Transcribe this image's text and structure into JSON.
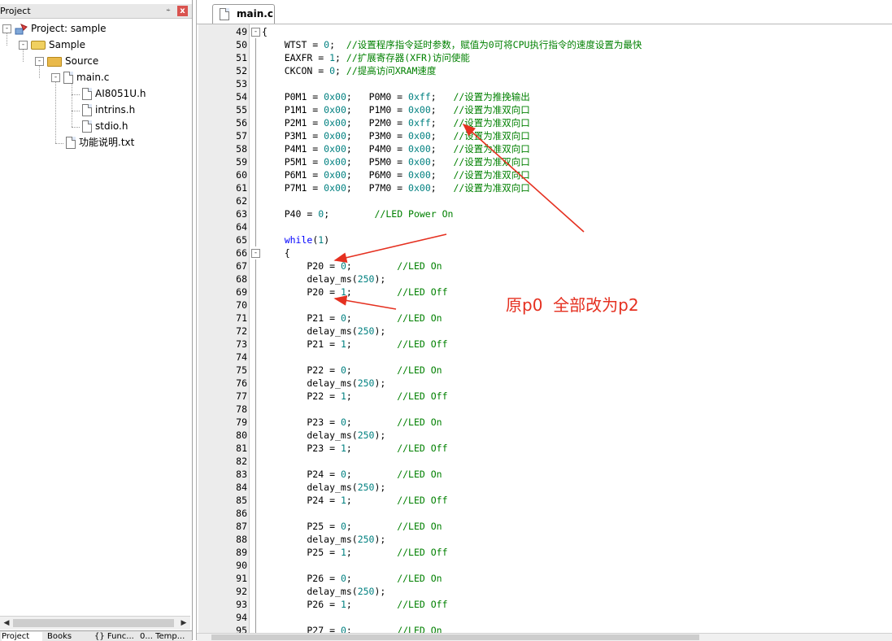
{
  "project_panel": {
    "title": "Project",
    "pin_glyph": "⍅",
    "close_glyph": "x",
    "tree": [
      {
        "label": "Project: sample",
        "icon": "project-icon",
        "expander": "-"
      },
      {
        "label": "Sample",
        "icon": "target-icon",
        "expander": "-"
      },
      {
        "label": "Source",
        "icon": "folder-icon",
        "expander": "-"
      },
      {
        "label": "main.c",
        "icon": "file-icon",
        "expander": "-"
      },
      {
        "label": "AI8051U.h",
        "icon": "file-icon"
      },
      {
        "label": "intrins.h",
        "icon": "file-icon"
      },
      {
        "label": "stdio.h",
        "icon": "file-icon"
      },
      {
        "label": "功能说明.txt",
        "icon": "file-icon"
      }
    ],
    "bottom_tabs": [
      "Project",
      "Books",
      "{} Func...",
      "0... Temp..."
    ]
  },
  "editor": {
    "tab_label": "main.c",
    "lines": [
      {
        "n": "49",
        "fold": "-",
        "code": [
          [
            "{",
            ""
          ]
        ]
      },
      {
        "n": "50",
        "code": [
          [
            "    WTST = ",
            ""
          ],
          [
            "0",
            "num"
          ],
          [
            ";  ",
            ""
          ],
          [
            "//设置程序指令延时参数，赋值为0可将CPU执行指令的速度设置为最快",
            "cm"
          ]
        ]
      },
      {
        "n": "51",
        "code": [
          [
            "    EAXFR = ",
            ""
          ],
          [
            "1",
            "num"
          ],
          [
            "; ",
            ""
          ],
          [
            "//扩展寄存器(XFR)访问使能",
            "cm"
          ]
        ]
      },
      {
        "n": "52",
        "code": [
          [
            "    CKCON = ",
            ""
          ],
          [
            "0",
            "num"
          ],
          [
            "; ",
            ""
          ],
          [
            "//提高访问XRAM速度",
            "cm"
          ]
        ]
      },
      {
        "n": "53",
        "code": []
      },
      {
        "n": "54",
        "code": [
          [
            "    P0M1 = ",
            ""
          ],
          [
            "0x00",
            "num"
          ],
          [
            ";   P0M0 = ",
            ""
          ],
          [
            "0xff",
            "num"
          ],
          [
            ";   ",
            ""
          ],
          [
            "//设置为推挽输出",
            "cm"
          ]
        ]
      },
      {
        "n": "55",
        "code": [
          [
            "    P1M1 = ",
            ""
          ],
          [
            "0x00",
            "num"
          ],
          [
            ";   P1M0 = ",
            ""
          ],
          [
            "0x00",
            "num"
          ],
          [
            ";   ",
            ""
          ],
          [
            "//设置为准双向口",
            "cm"
          ]
        ]
      },
      {
        "n": "56",
        "code": [
          [
            "    P2M1 = ",
            ""
          ],
          [
            "0x00",
            "num"
          ],
          [
            ";   P2M0 = ",
            ""
          ],
          [
            "0xff",
            "num"
          ],
          [
            ";   ",
            ""
          ],
          [
            "//设置为准双向口",
            "cm"
          ]
        ]
      },
      {
        "n": "57",
        "code": [
          [
            "    P3M1 = ",
            ""
          ],
          [
            "0x00",
            "num"
          ],
          [
            ";   P3M0 = ",
            ""
          ],
          [
            "0x00",
            "num"
          ],
          [
            ";   ",
            ""
          ],
          [
            "//设置为准双向口",
            "cm"
          ]
        ]
      },
      {
        "n": "58",
        "code": [
          [
            "    P4M1 = ",
            ""
          ],
          [
            "0x00",
            "num"
          ],
          [
            ";   P4M0 = ",
            ""
          ],
          [
            "0x00",
            "num"
          ],
          [
            ";   ",
            ""
          ],
          [
            "//设置为准双向口",
            "cm"
          ]
        ]
      },
      {
        "n": "59",
        "code": [
          [
            "    P5M1 = ",
            ""
          ],
          [
            "0x00",
            "num"
          ],
          [
            ";   P5M0 = ",
            ""
          ],
          [
            "0x00",
            "num"
          ],
          [
            ";   ",
            ""
          ],
          [
            "//设置为准双向口",
            "cm"
          ]
        ]
      },
      {
        "n": "60",
        "code": [
          [
            "    P6M1 = ",
            ""
          ],
          [
            "0x00",
            "num"
          ],
          [
            ";   P6M0 = ",
            ""
          ],
          [
            "0x00",
            "num"
          ],
          [
            ";   ",
            ""
          ],
          [
            "//设置为准双向口",
            "cm"
          ]
        ]
      },
      {
        "n": "61",
        "code": [
          [
            "    P7M1 = ",
            ""
          ],
          [
            "0x00",
            "num"
          ],
          [
            ";   P7M0 = ",
            ""
          ],
          [
            "0x00",
            "num"
          ],
          [
            ";   ",
            ""
          ],
          [
            "//设置为准双向口",
            "cm"
          ]
        ]
      },
      {
        "n": "62",
        "code": []
      },
      {
        "n": "63",
        "code": [
          [
            "    P40 = ",
            ""
          ],
          [
            "0",
            "num"
          ],
          [
            ";        ",
            ""
          ],
          [
            "//LED Power On",
            "cm"
          ]
        ]
      },
      {
        "n": "64",
        "code": []
      },
      {
        "n": "65",
        "code": [
          [
            "    ",
            ""
          ],
          [
            "while",
            "kw"
          ],
          [
            "(",
            ""
          ],
          [
            "1",
            "num"
          ],
          [
            ")",
            ""
          ]
        ]
      },
      {
        "n": "66",
        "fold": "-",
        "code": [
          [
            "    {",
            ""
          ]
        ]
      },
      {
        "n": "67",
        "code": [
          [
            "        P20 = ",
            ""
          ],
          [
            "0",
            "num"
          ],
          [
            ";        ",
            ""
          ],
          [
            "//LED On",
            "cm"
          ]
        ]
      },
      {
        "n": "68",
        "code": [
          [
            "        delay_ms(",
            ""
          ],
          [
            "250",
            "num"
          ],
          [
            ");",
            ""
          ]
        ]
      },
      {
        "n": "69",
        "code": [
          [
            "        P20 = ",
            ""
          ],
          [
            "1",
            "num"
          ],
          [
            ";        ",
            ""
          ],
          [
            "//LED Off",
            "cm"
          ]
        ]
      },
      {
        "n": "70",
        "code": []
      },
      {
        "n": "71",
        "code": [
          [
            "        P21 = ",
            ""
          ],
          [
            "0",
            "num"
          ],
          [
            ";        ",
            ""
          ],
          [
            "//LED On",
            "cm"
          ]
        ]
      },
      {
        "n": "72",
        "code": [
          [
            "        delay_ms(",
            ""
          ],
          [
            "250",
            "num"
          ],
          [
            ");",
            ""
          ]
        ]
      },
      {
        "n": "73",
        "code": [
          [
            "        P21 = ",
            ""
          ],
          [
            "1",
            "num"
          ],
          [
            ";        ",
            ""
          ],
          [
            "//LED Off",
            "cm"
          ]
        ]
      },
      {
        "n": "74",
        "code": []
      },
      {
        "n": "75",
        "code": [
          [
            "        P22 = ",
            ""
          ],
          [
            "0",
            "num"
          ],
          [
            ";        ",
            ""
          ],
          [
            "//LED On",
            "cm"
          ]
        ]
      },
      {
        "n": "76",
        "code": [
          [
            "        delay_ms(",
            ""
          ],
          [
            "250",
            "num"
          ],
          [
            ");",
            ""
          ]
        ]
      },
      {
        "n": "77",
        "code": [
          [
            "        P22 = ",
            ""
          ],
          [
            "1",
            "num"
          ],
          [
            ";        ",
            ""
          ],
          [
            "//LED Off",
            "cm"
          ]
        ]
      },
      {
        "n": "78",
        "code": []
      },
      {
        "n": "79",
        "code": [
          [
            "        P23 = ",
            ""
          ],
          [
            "0",
            "num"
          ],
          [
            ";        ",
            ""
          ],
          [
            "//LED On",
            "cm"
          ]
        ]
      },
      {
        "n": "80",
        "code": [
          [
            "        delay_ms(",
            ""
          ],
          [
            "250",
            "num"
          ],
          [
            ");",
            ""
          ]
        ]
      },
      {
        "n": "81",
        "code": [
          [
            "        P23 = ",
            ""
          ],
          [
            "1",
            "num"
          ],
          [
            ";        ",
            ""
          ],
          [
            "//LED Off",
            "cm"
          ]
        ]
      },
      {
        "n": "82",
        "code": []
      },
      {
        "n": "83",
        "code": [
          [
            "        P24 = ",
            ""
          ],
          [
            "0",
            "num"
          ],
          [
            ";        ",
            ""
          ],
          [
            "//LED On",
            "cm"
          ]
        ]
      },
      {
        "n": "84",
        "code": [
          [
            "        delay_ms(",
            ""
          ],
          [
            "250",
            "num"
          ],
          [
            ");",
            ""
          ]
        ]
      },
      {
        "n": "85",
        "code": [
          [
            "        P24 = ",
            ""
          ],
          [
            "1",
            "num"
          ],
          [
            ";        ",
            ""
          ],
          [
            "//LED Off",
            "cm"
          ]
        ]
      },
      {
        "n": "86",
        "code": []
      },
      {
        "n": "87",
        "code": [
          [
            "        P25 = ",
            ""
          ],
          [
            "0",
            "num"
          ],
          [
            ";        ",
            ""
          ],
          [
            "//LED On",
            "cm"
          ]
        ]
      },
      {
        "n": "88",
        "code": [
          [
            "        delay_ms(",
            ""
          ],
          [
            "250",
            "num"
          ],
          [
            ");",
            ""
          ]
        ]
      },
      {
        "n": "89",
        "code": [
          [
            "        P25 = ",
            ""
          ],
          [
            "1",
            "num"
          ],
          [
            ";        ",
            ""
          ],
          [
            "//LED Off",
            "cm"
          ]
        ]
      },
      {
        "n": "90",
        "code": []
      },
      {
        "n": "91",
        "code": [
          [
            "        P26 = ",
            ""
          ],
          [
            "0",
            "num"
          ],
          [
            ";        ",
            ""
          ],
          [
            "//LED On",
            "cm"
          ]
        ]
      },
      {
        "n": "92",
        "code": [
          [
            "        delay_ms(",
            ""
          ],
          [
            "250",
            "num"
          ],
          [
            ");",
            ""
          ]
        ]
      },
      {
        "n": "93",
        "code": [
          [
            "        P26 = ",
            ""
          ],
          [
            "1",
            "num"
          ],
          [
            ";        ",
            ""
          ],
          [
            "//LED Off",
            "cm"
          ]
        ]
      },
      {
        "n": "94",
        "code": []
      },
      {
        "n": "95",
        "code": [
          [
            "        P27 = ",
            ""
          ],
          [
            "0",
            "num"
          ],
          [
            ";        ",
            ""
          ],
          [
            "//LED On",
            "cm"
          ]
        ]
      }
    ]
  },
  "annotation": {
    "text": "原p0  全部改为p2",
    "color": "#e53020"
  },
  "colors": {
    "keyword": "#0000ff",
    "number": "#008080",
    "comment": "#008000"
  }
}
